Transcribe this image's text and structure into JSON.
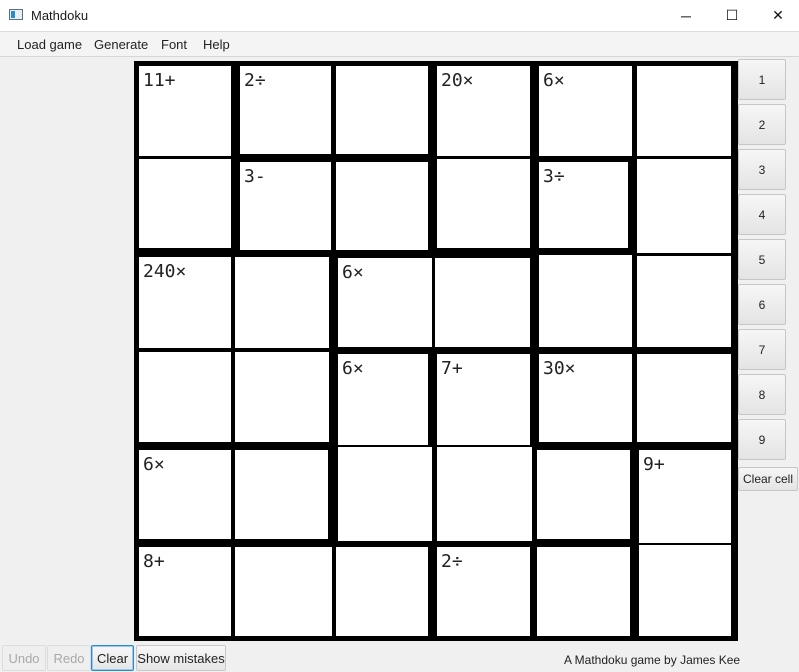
{
  "window": {
    "title": "Mathdoku",
    "controls": {
      "minimize": "─",
      "maximize": "☐",
      "close": "✕"
    }
  },
  "menu": {
    "items": [
      "Load game",
      "Generate",
      "Font",
      "Help"
    ]
  },
  "grid": {
    "size": 6,
    "cages": [
      {
        "label": "11+"
      },
      {
        "label": "2÷"
      },
      {
        "label": "20×"
      },
      {
        "label": "6×"
      },
      {
        "label": "3-"
      },
      {
        "label": "3÷"
      },
      {
        "label": "240×"
      },
      {
        "label": "6×"
      },
      {
        "label": "6×"
      },
      {
        "label": "7+"
      },
      {
        "label": "30×"
      },
      {
        "label": "6×"
      },
      {
        "label": "9+"
      },
      {
        "label": "8+"
      },
      {
        "label": "2÷"
      }
    ]
  },
  "numpad": {
    "buttons": [
      "1",
      "2",
      "3",
      "4",
      "5",
      "6",
      "7",
      "8",
      "9"
    ],
    "clear_cell": "Clear cell"
  },
  "footer": {
    "undo": "Undo",
    "redo": "Redo",
    "clear": "Clear",
    "show_mistakes": "Show mistakes",
    "credit": "A Mathdoku game by James Kee"
  }
}
